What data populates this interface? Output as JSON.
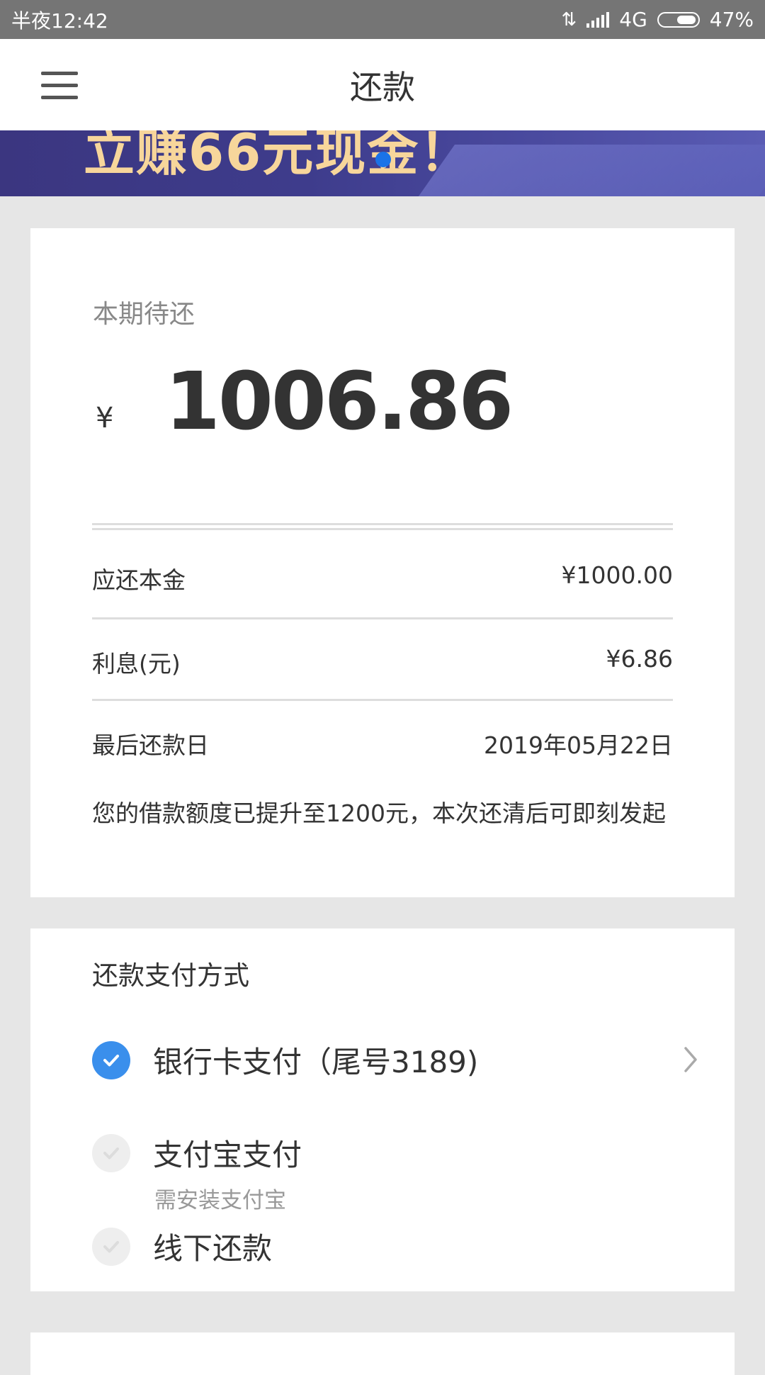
{
  "status_bar": {
    "time": "半夜12:42",
    "network": "4G",
    "battery": "47%"
  },
  "nav": {
    "title": "还款",
    "menu_icon": "menu-icon"
  },
  "banner": {
    "text": "立赚66元现金！"
  },
  "summary": {
    "due_label": "本期待还",
    "currency_symbol": "¥",
    "amount": "1006.86",
    "rows": [
      {
        "label": "应还本金",
        "value": "¥1000.00"
      },
      {
        "label": "利息(元)",
        "value": "¥6.86"
      },
      {
        "label": "最后还款日",
        "value": "2019年05月22日"
      }
    ],
    "notice": "您的借款额度已提升至1200元，本次还清后可即刻发起"
  },
  "payment": {
    "title": "还款支付方式",
    "methods": [
      {
        "label": "银行卡支付（尾号3189)",
        "selected": true
      },
      {
        "label": "支付宝支付",
        "sub": "需安装支付宝",
        "selected": false
      },
      {
        "label": "线下还款",
        "selected": false
      }
    ]
  },
  "colors": {
    "accent": "#3a8fec",
    "status_bar": "#757575",
    "background": "#e6e6e6",
    "banner_text": "#f7d69b"
  }
}
